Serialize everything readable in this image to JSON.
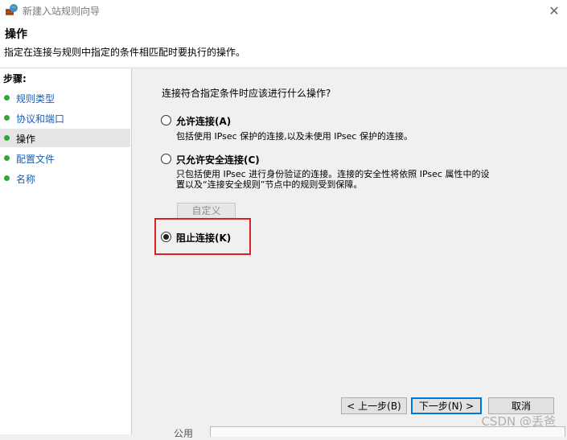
{
  "window": {
    "title": "新建入站规则向导",
    "close_glyph": "✕"
  },
  "header": {
    "title": "操作",
    "description": "指定在连接与规则中指定的条件相匹配时要执行的操作。"
  },
  "steps": {
    "title": "步骤:",
    "items": [
      {
        "label": "规则类型",
        "active": false
      },
      {
        "label": "协议和端口",
        "active": false
      },
      {
        "label": "操作",
        "active": true
      },
      {
        "label": "配置文件",
        "active": false
      },
      {
        "label": "名称",
        "active": false
      }
    ]
  },
  "main": {
    "question": "连接符合指定条件时应该进行什么操作?",
    "options": [
      {
        "label": "允许连接(A)",
        "desc": "包括使用 IPsec 保护的连接,以及未使用 IPsec 保护的连接。",
        "checked": false
      },
      {
        "label": "只允许安全连接(C)",
        "desc_line1": "只包括使用 IPsec 进行身份验证的连接。连接的安全性将依照 IPsec 属性中的设",
        "desc_line2": "置以及“连接安全规则”节点中的规则受到保障。",
        "checked": false
      },
      {
        "label": "阻止连接(K)",
        "checked": true
      }
    ],
    "custom_button": "自定义",
    "partial_text": "公用"
  },
  "footer": {
    "back": "< 上一步(B)",
    "next": "下一步(N) >",
    "cancel": "取消"
  },
  "watermark": "CSDN @丢爸",
  "colors": {
    "step_dot": "#2fa836",
    "step_link": "#1a5fb4",
    "highlight": "#e02020"
  }
}
